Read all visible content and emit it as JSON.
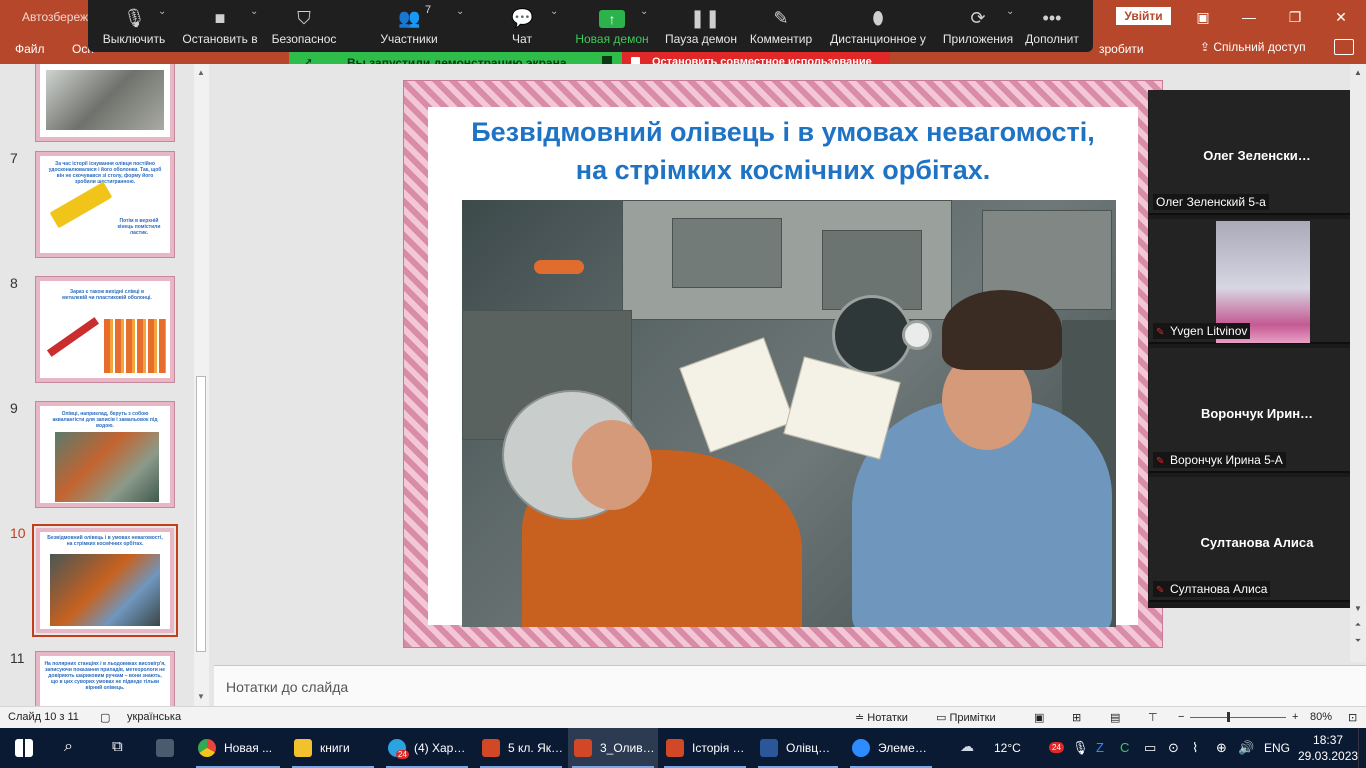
{
  "ppt": {
    "autosave": "Автозбереж",
    "signin": "Увійти",
    "menu": {
      "file": "Файл",
      "home_partial": "Осн",
      "partial_right": "зробити",
      "share": "Спільний доступ"
    }
  },
  "zoom_toolbar": {
    "mute": "Выключить",
    "stop_video": "Остановить в",
    "security": "Безопаснос",
    "participants": "Участники",
    "participant_count": "7",
    "chat": "Чат",
    "new_share": "Новая демон",
    "pause_share": "Пауза демон",
    "annotate": "Комментир",
    "remote_control": "Дистанционное у",
    "apps": "Приложения",
    "more": "Дополнит"
  },
  "share_banner": {
    "text": "Вы запустили демонстрацию экрана",
    "stop": "Остановить совместное использование"
  },
  "thumbnails": [
    {
      "num": "7",
      "text": "За час історії існування олівця постійно удосконалювалися і його оболонки. Так, щоб він не скочувався зі столу, форму його зробили шестигранною.",
      "text2": "Потім в верхній кінець помістили ластик."
    },
    {
      "num": "8",
      "text": "Зараз є також вихідні слівці в металевій чи пластиковій оболонці."
    },
    {
      "num": "9",
      "text": "Олівці, наприклад, беруть з собою аквалангісти для записів і замальовок під водою."
    },
    {
      "num": "10",
      "text": "Безвідмовний олівець і в умовах невагомості, на стрімких космічних орбітах."
    },
    {
      "num": "11",
      "text": "На полярних станціях і в льодовиках висовігр'я, записуючи показання приладів, метеорологи не довіряють шариковим ручкам – вони знають, що в цих суворих умовах не підведе тільки вірний олівець."
    }
  ],
  "slide": {
    "title_line1": "Безвідмовний олівець і в умовах невагомості,",
    "title_line2": "на стрімких космічних орбітах."
  },
  "notes_placeholder": "Нотатки до слайда",
  "participants": [
    {
      "display": "Олег  Зеленски…",
      "tag": "Олег Зеленский 5-а",
      "muted": false,
      "video": false
    },
    {
      "display": "",
      "tag": "Yvgen Litvinov",
      "muted": true,
      "video": true
    },
    {
      "display": "Ворончук  Ирин…",
      "tag": "Ворончук Ирина 5-А",
      "muted": true,
      "video": false
    },
    {
      "display": "Султанова Алиса",
      "tag": "Султанова Алиса",
      "muted": true,
      "video": false
    }
  ],
  "status": {
    "slide_of": "Слайд 10 з 11",
    "language": "українська",
    "notes": "Нотатки",
    "comments": "Примітки",
    "zoom": "80%"
  },
  "taskbar": {
    "items": [
      {
        "label": "Новая ...",
        "icon": "chrome-icon",
        "color": "#e8453c"
      },
      {
        "label": "книги",
        "icon": "folder-icon",
        "color": "#f2c12e"
      },
      {
        "label": "(4) Хар…",
        "icon": "telegram-icon",
        "color": "#2aa3e0",
        "badge": "24"
      },
      {
        "label": "5 кл. Як…",
        "icon": "powerpoint-icon",
        "color": "#d24726"
      },
      {
        "label": "3_Олив…",
        "icon": "powerpoint-icon",
        "color": "#d24726",
        "active": true
      },
      {
        "label": "Історія …",
        "icon": "powerpoint-icon",
        "color": "#d24726"
      },
      {
        "label": "Олівц…",
        "icon": "word-icon",
        "color": "#2b579a"
      },
      {
        "label": "Элеме…",
        "icon": "zoom-icon",
        "color": "#2d8cff"
      }
    ],
    "weather": "12°C",
    "tray_badge": "24",
    "lang": "ENG",
    "time": "18:37",
    "date": "29.03.2023"
  }
}
